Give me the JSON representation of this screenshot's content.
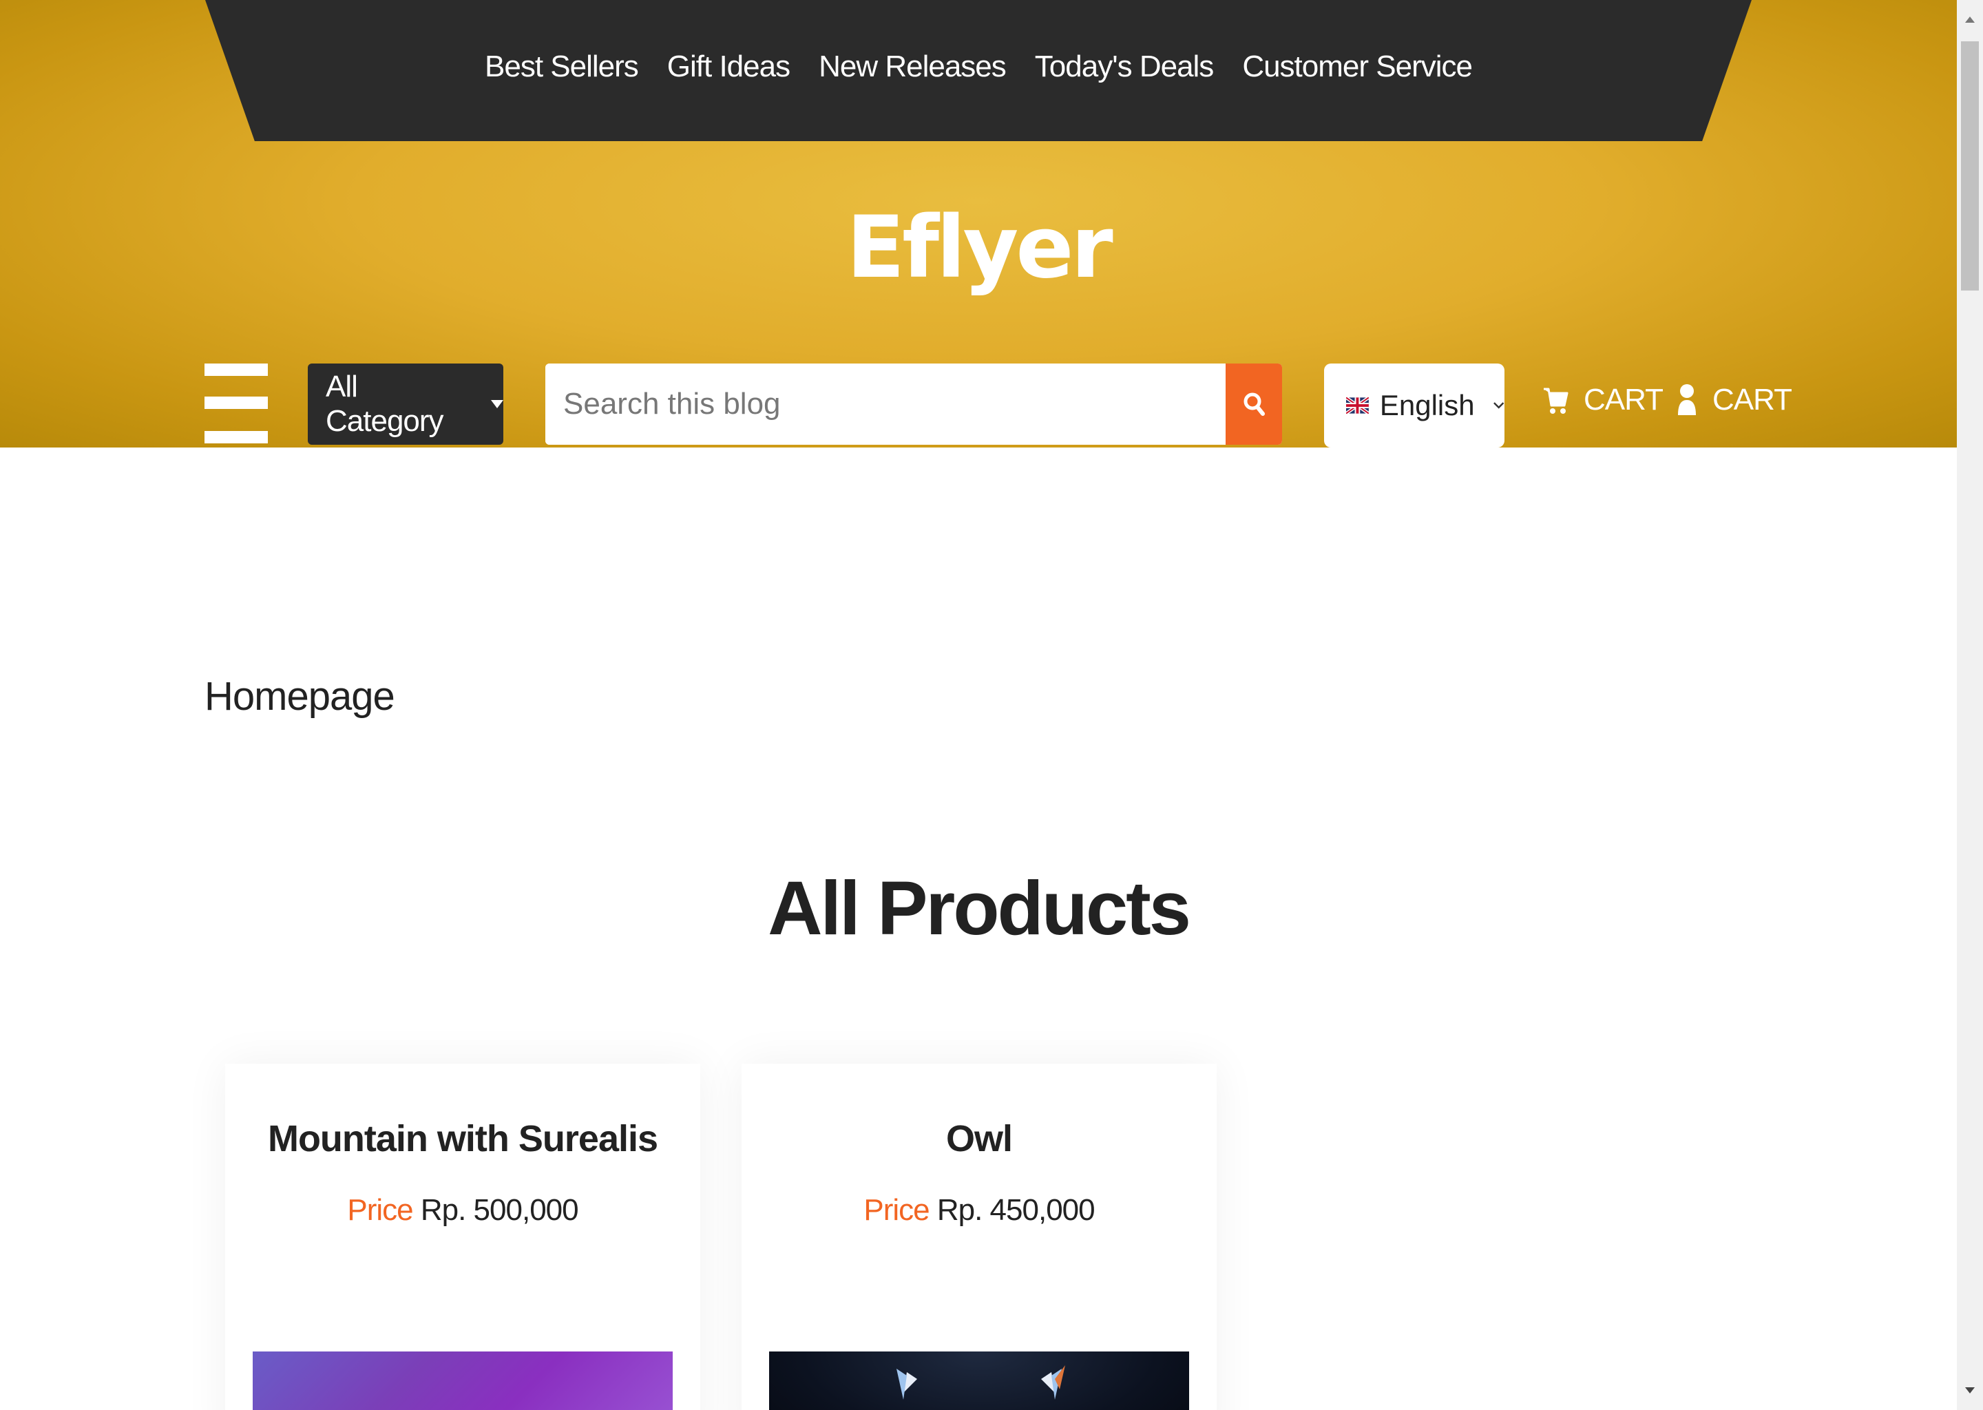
{
  "nav": {
    "items": [
      "Best Sellers",
      "Gift Ideas",
      "New Releases",
      "Today's Deals",
      "Customer Service"
    ]
  },
  "brand": {
    "logo": "Eflyer"
  },
  "toolbar": {
    "category_label": "All Category",
    "search_placeholder": "Search this blog",
    "language": "English",
    "cart_label": "CART",
    "account_label": "CART"
  },
  "breadcrumb": "Homepage",
  "section_title": "All Products",
  "products": [
    {
      "name": "Mountain with Surealis",
      "price_label": "Price",
      "price": "Rp. 500,000"
    },
    {
      "name": "Owl",
      "price_label": "Price",
      "price": "Rp. 450,000"
    }
  ],
  "colors": {
    "accent": "#f26522",
    "banner": "#e1ad2c",
    "dark": "#2b2b2b"
  },
  "icons": {
    "menu": "hamburger-icon",
    "search": "search-icon",
    "flag": "uk-flag-icon",
    "cart": "cart-icon",
    "user": "user-icon"
  }
}
